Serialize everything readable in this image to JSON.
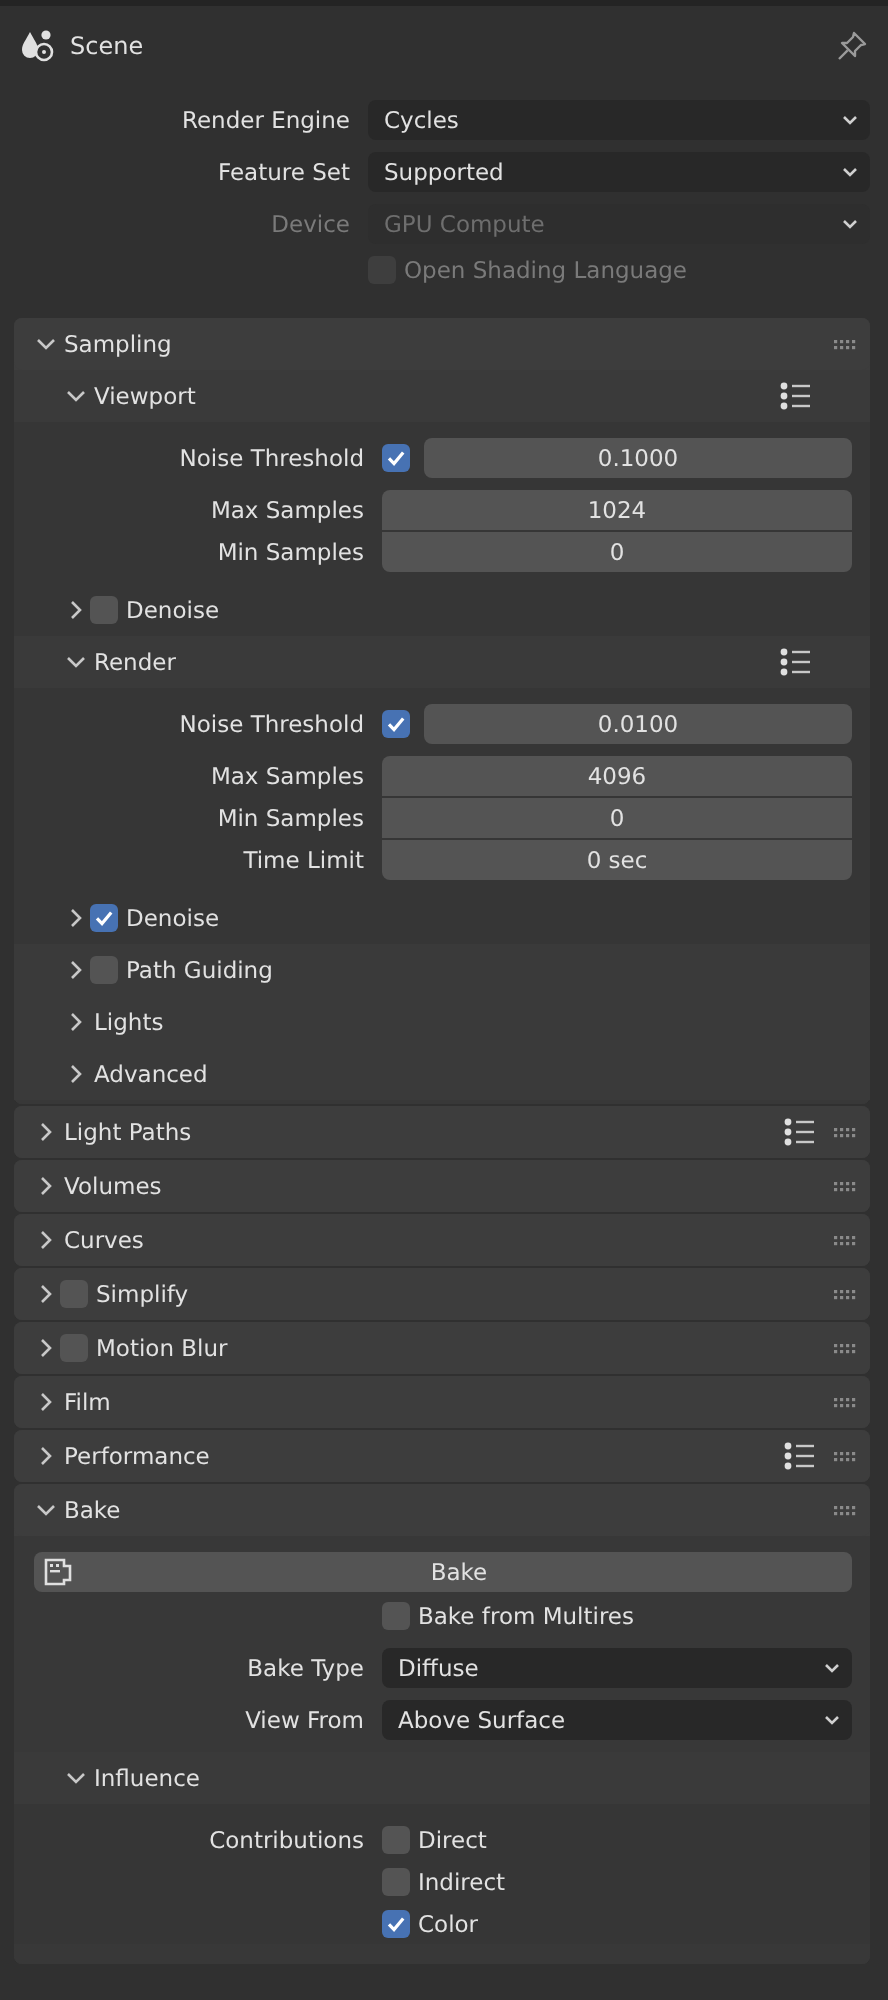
{
  "header": {
    "title": "Scene"
  },
  "top_rows": [
    {
      "kind": "dropdown",
      "label": "Render Engine",
      "value": "Cycles",
      "disabled": false
    },
    {
      "kind": "dropdown",
      "label": "Feature Set",
      "value": "Supported",
      "disabled": false
    },
    {
      "kind": "dropdown",
      "label": "Device",
      "value": "GPU Compute",
      "disabled": true
    },
    {
      "kind": "checkbox",
      "text": "Open Shading Language",
      "checked": false,
      "disabled": true
    }
  ],
  "panels": [
    {
      "title": "Sampling",
      "expanded": true,
      "presets": false,
      "rows": [
        {
          "kind": "subpanel",
          "title": "Viewport",
          "expanded": true,
          "presets": true,
          "rows": [
            {
              "kind": "toggle_number",
              "label": "Noise Threshold",
              "checked": true,
              "value": "0.1000"
            },
            {
              "kind": "numbers",
              "items": [
                {
                  "label": "Max Samples",
                  "value": "1024"
                },
                {
                  "label": "Min Samples",
                  "value": "0"
                }
              ]
            },
            {
              "kind": "subpanel",
              "title": "Denoise",
              "expanded": false,
              "checked": false,
              "presets": false
            }
          ]
        },
        {
          "kind": "subpanel",
          "title": "Render",
          "expanded": true,
          "presets": true,
          "rows": [
            {
              "kind": "toggle_number",
              "label": "Noise Threshold",
              "checked": true,
              "value": "0.0100"
            },
            {
              "kind": "numbers",
              "items": [
                {
                  "label": "Max Samples",
                  "value": "4096"
                },
                {
                  "label": "Min Samples",
                  "value": "0"
                },
                {
                  "label": "Time Limit",
                  "value": "0 sec"
                }
              ]
            },
            {
              "kind": "subpanel",
              "title": "Denoise",
              "expanded": false,
              "checked": true,
              "presets": false
            }
          ]
        },
        {
          "kind": "subpanel",
          "title": "Path Guiding",
          "expanded": false,
          "checked": false,
          "presets": false
        },
        {
          "kind": "subpanel",
          "title": "Lights",
          "expanded": false,
          "presets": false
        },
        {
          "kind": "subpanel",
          "title": "Advanced",
          "expanded": false,
          "presets": false
        }
      ]
    },
    {
      "title": "Light Paths",
      "expanded": false,
      "presets": true
    },
    {
      "title": "Volumes",
      "expanded": false,
      "presets": false
    },
    {
      "title": "Curves",
      "expanded": false,
      "presets": false
    },
    {
      "title": "Simplify",
      "expanded": false,
      "checked": false,
      "presets": false
    },
    {
      "title": "Motion Blur",
      "expanded": false,
      "checked": false,
      "presets": false
    },
    {
      "title": "Film",
      "expanded": false,
      "presets": false
    },
    {
      "title": "Performance",
      "expanded": false,
      "presets": true
    },
    {
      "title": "Bake",
      "expanded": true,
      "presets": false,
      "rows": [
        {
          "kind": "button",
          "text": "Bake"
        },
        {
          "kind": "checkbox",
          "text": "Bake from Multires",
          "checked": false,
          "disabled": false
        },
        {
          "kind": "dropdown",
          "label": "Bake Type",
          "value": "Diffuse",
          "disabled": false
        },
        {
          "kind": "dropdown",
          "label": "View From",
          "value": "Above Surface",
          "disabled": false
        },
        {
          "kind": "subpanel",
          "title": "Influence",
          "expanded": true,
          "presets": false,
          "rows": [
            {
              "kind": "checkgroup",
              "label": "Contributions",
              "items": [
                {
                  "text": "Direct",
                  "checked": false
                },
                {
                  "text": "Indirect",
                  "checked": false
                },
                {
                  "text": "Color",
                  "checked": true
                }
              ]
            }
          ]
        }
      ]
    }
  ]
}
